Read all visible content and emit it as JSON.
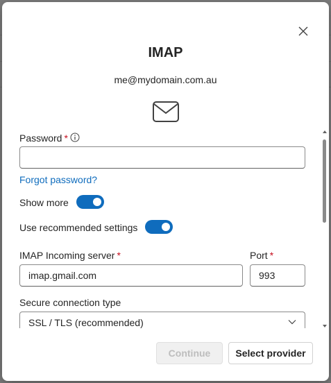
{
  "dialog": {
    "title": "IMAP",
    "email": "me@mydomain.com.au",
    "close_icon": "close-icon",
    "header_icon": "mail-icon"
  },
  "password": {
    "label": "Password",
    "required_marker": "*",
    "info_icon": "info-icon",
    "value": "",
    "forgot_link": "Forgot password?"
  },
  "toggles": {
    "show_more": {
      "label": "Show more",
      "on": true
    },
    "recommended": {
      "label": "Use recommended settings",
      "on": true
    }
  },
  "incoming": {
    "server_label": "IMAP Incoming server",
    "server_required": "*",
    "server_value": "imap.gmail.com",
    "port_label": "Port",
    "port_required": "*",
    "port_value": "993"
  },
  "security": {
    "label": "Secure connection type",
    "selected": "SSL / TLS (recommended)"
  },
  "footer": {
    "continue_label": "Continue",
    "select_provider_label": "Select provider"
  },
  "colors": {
    "accent": "#0f6cbd",
    "required": "#c50f1f"
  }
}
